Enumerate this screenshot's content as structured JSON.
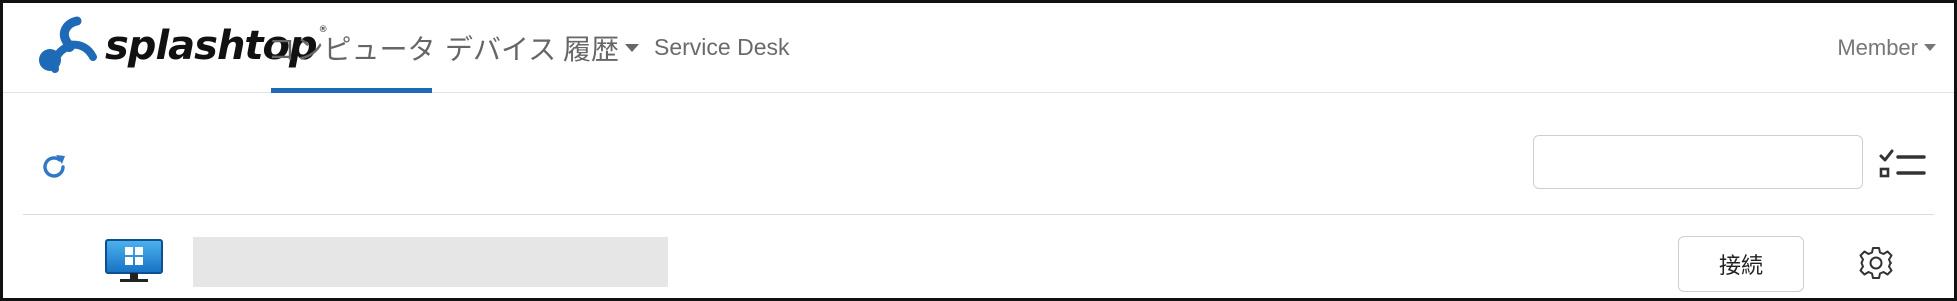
{
  "brand": {
    "name": "splashtop",
    "registered": "®",
    "accent": "#1f6ab6"
  },
  "nav": {
    "items": [
      {
        "label": "コンピュータ",
        "active": true
      },
      {
        "label": "デバイス",
        "active": false
      },
      {
        "label": "履歴",
        "active": false,
        "dropdown": true
      },
      {
        "label": "Service Desk",
        "active": false
      }
    ],
    "account": {
      "label": "Member",
      "dropdown": true
    }
  },
  "toolbar": {
    "refresh_icon": "refresh-icon",
    "search": {
      "value": "",
      "placeholder": ""
    },
    "filter_icon": "checklist-icon"
  },
  "computers": [
    {
      "icon": "windows-monitor-icon",
      "name": "",
      "connect_label": "接続",
      "settings_icon": "gear-icon"
    }
  ]
}
